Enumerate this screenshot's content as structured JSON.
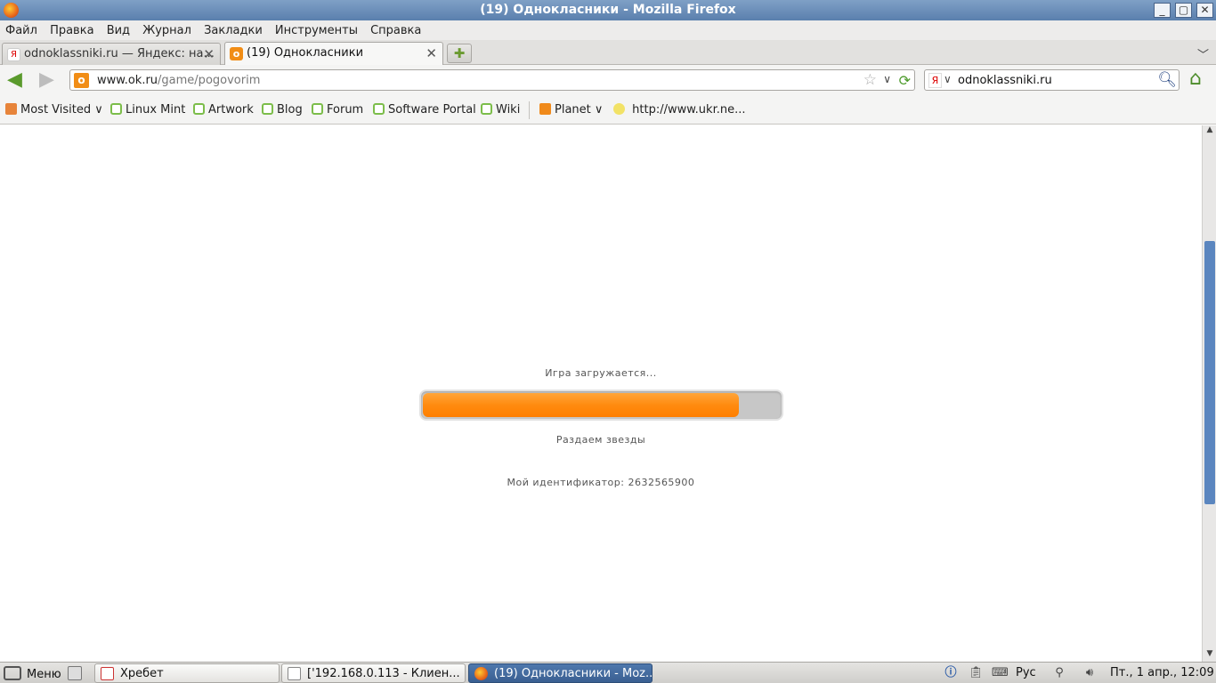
{
  "window": {
    "title": "(19) Однокласники - Mozilla Firefox",
    "buttons": {
      "minimize": "_",
      "maximize": "▢",
      "close": "✕"
    }
  },
  "menubar": {
    "items": [
      "Файл",
      "Правка",
      "Вид",
      "Журнал",
      "Закладки",
      "Инструменты",
      "Справка"
    ]
  },
  "tabs": [
    {
      "label": "odnoklassniki.ru — Яндекс: на...",
      "icon": "yandex-icon",
      "active": false
    },
    {
      "label": "(19) Однокласники",
      "icon": "odnoklassniki-icon",
      "active": true
    }
  ],
  "navbar": {
    "url_domain": "www.ok.ru",
    "url_path": "/game/pogovorim",
    "search_value": "odnoklassniki.ru"
  },
  "bookmarks": [
    {
      "label": "Most Visited",
      "icon": "most-visited-icon",
      "dropdown": true
    },
    {
      "label": "Linux Mint",
      "icon": "mint-icon"
    },
    {
      "label": "Artwork",
      "icon": "mint-icon"
    },
    {
      "label": "Blog",
      "icon": "mint-icon"
    },
    {
      "label": "Forum",
      "icon": "mint-icon"
    },
    {
      "label": "Software Portal",
      "icon": "mint-icon"
    },
    {
      "label": "Wiki",
      "icon": "mint-icon"
    },
    {
      "label": "Planet",
      "icon": "rss-icon",
      "dropdown": true
    },
    {
      "label": "http://www.ukr.ne...",
      "icon": "ukr-net-icon"
    }
  ],
  "game": {
    "loading_label": "Игра загружается...",
    "progress_fraction": 0.885,
    "status_label": "Раздаем звезды",
    "user_id_label": "Мой идентификатор: 2632565900"
  },
  "taskbar": {
    "menu_label": "Меню",
    "windows": [
      {
        "label": "Хребет",
        "icon": "solitaire-icon",
        "active": false
      },
      {
        "label": "['192.168.0.113 - Клиен...",
        "icon": "window-icon",
        "active": false
      },
      {
        "label": "(19) Однокласники - Moz...",
        "icon": "firefox-icon",
        "active": true
      }
    ],
    "keyboard_layout": "Рус",
    "clock": "Пт.,  1 апр., 12:09"
  },
  "colors": {
    "progress_fill": "#ff8b0f",
    "progress_track": "#c7c7c7",
    "titlebar": "#5a7fad",
    "scroll_thumb": "#5b86bf"
  }
}
